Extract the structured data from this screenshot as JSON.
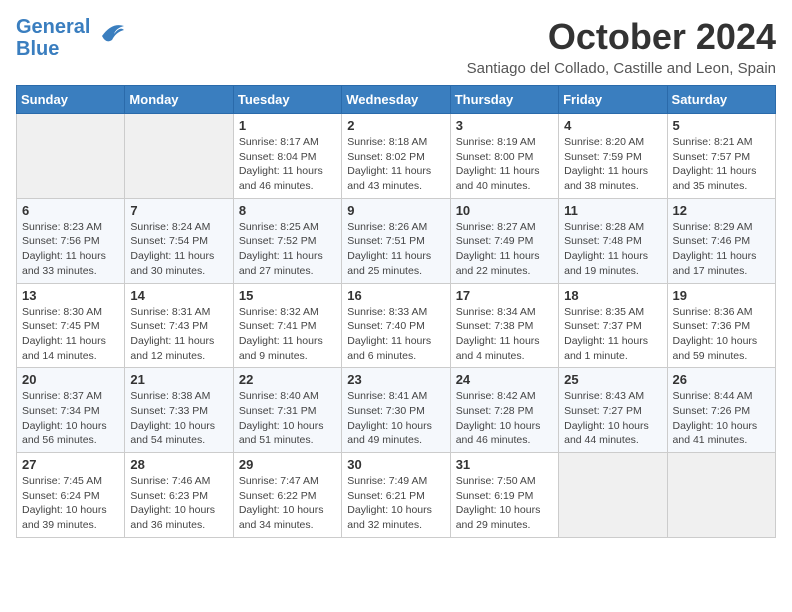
{
  "logo": {
    "line1": "General",
    "line2": "Blue"
  },
  "title": "October 2024",
  "location": "Santiago del Collado, Castille and Leon, Spain",
  "days_of_week": [
    "Sunday",
    "Monday",
    "Tuesday",
    "Wednesday",
    "Thursday",
    "Friday",
    "Saturday"
  ],
  "weeks": [
    [
      {
        "day": "",
        "info": ""
      },
      {
        "day": "",
        "info": ""
      },
      {
        "day": "1",
        "info": "Sunrise: 8:17 AM\nSunset: 8:04 PM\nDaylight: 11 hours and 46 minutes."
      },
      {
        "day": "2",
        "info": "Sunrise: 8:18 AM\nSunset: 8:02 PM\nDaylight: 11 hours and 43 minutes."
      },
      {
        "day": "3",
        "info": "Sunrise: 8:19 AM\nSunset: 8:00 PM\nDaylight: 11 hours and 40 minutes."
      },
      {
        "day": "4",
        "info": "Sunrise: 8:20 AM\nSunset: 7:59 PM\nDaylight: 11 hours and 38 minutes."
      },
      {
        "day": "5",
        "info": "Sunrise: 8:21 AM\nSunset: 7:57 PM\nDaylight: 11 hours and 35 minutes."
      }
    ],
    [
      {
        "day": "6",
        "info": "Sunrise: 8:23 AM\nSunset: 7:56 PM\nDaylight: 11 hours and 33 minutes."
      },
      {
        "day": "7",
        "info": "Sunrise: 8:24 AM\nSunset: 7:54 PM\nDaylight: 11 hours and 30 minutes."
      },
      {
        "day": "8",
        "info": "Sunrise: 8:25 AM\nSunset: 7:52 PM\nDaylight: 11 hours and 27 minutes."
      },
      {
        "day": "9",
        "info": "Sunrise: 8:26 AM\nSunset: 7:51 PM\nDaylight: 11 hours and 25 minutes."
      },
      {
        "day": "10",
        "info": "Sunrise: 8:27 AM\nSunset: 7:49 PM\nDaylight: 11 hours and 22 minutes."
      },
      {
        "day": "11",
        "info": "Sunrise: 8:28 AM\nSunset: 7:48 PM\nDaylight: 11 hours and 19 minutes."
      },
      {
        "day": "12",
        "info": "Sunrise: 8:29 AM\nSunset: 7:46 PM\nDaylight: 11 hours and 17 minutes."
      }
    ],
    [
      {
        "day": "13",
        "info": "Sunrise: 8:30 AM\nSunset: 7:45 PM\nDaylight: 11 hours and 14 minutes."
      },
      {
        "day": "14",
        "info": "Sunrise: 8:31 AM\nSunset: 7:43 PM\nDaylight: 11 hours and 12 minutes."
      },
      {
        "day": "15",
        "info": "Sunrise: 8:32 AM\nSunset: 7:41 PM\nDaylight: 11 hours and 9 minutes."
      },
      {
        "day": "16",
        "info": "Sunrise: 8:33 AM\nSunset: 7:40 PM\nDaylight: 11 hours and 6 minutes."
      },
      {
        "day": "17",
        "info": "Sunrise: 8:34 AM\nSunset: 7:38 PM\nDaylight: 11 hours and 4 minutes."
      },
      {
        "day": "18",
        "info": "Sunrise: 8:35 AM\nSunset: 7:37 PM\nDaylight: 11 hours and 1 minute."
      },
      {
        "day": "19",
        "info": "Sunrise: 8:36 AM\nSunset: 7:36 PM\nDaylight: 10 hours and 59 minutes."
      }
    ],
    [
      {
        "day": "20",
        "info": "Sunrise: 8:37 AM\nSunset: 7:34 PM\nDaylight: 10 hours and 56 minutes."
      },
      {
        "day": "21",
        "info": "Sunrise: 8:38 AM\nSunset: 7:33 PM\nDaylight: 10 hours and 54 minutes."
      },
      {
        "day": "22",
        "info": "Sunrise: 8:40 AM\nSunset: 7:31 PM\nDaylight: 10 hours and 51 minutes."
      },
      {
        "day": "23",
        "info": "Sunrise: 8:41 AM\nSunset: 7:30 PM\nDaylight: 10 hours and 49 minutes."
      },
      {
        "day": "24",
        "info": "Sunrise: 8:42 AM\nSunset: 7:28 PM\nDaylight: 10 hours and 46 minutes."
      },
      {
        "day": "25",
        "info": "Sunrise: 8:43 AM\nSunset: 7:27 PM\nDaylight: 10 hours and 44 minutes."
      },
      {
        "day": "26",
        "info": "Sunrise: 8:44 AM\nSunset: 7:26 PM\nDaylight: 10 hours and 41 minutes."
      }
    ],
    [
      {
        "day": "27",
        "info": "Sunrise: 7:45 AM\nSunset: 6:24 PM\nDaylight: 10 hours and 39 minutes."
      },
      {
        "day": "28",
        "info": "Sunrise: 7:46 AM\nSunset: 6:23 PM\nDaylight: 10 hours and 36 minutes."
      },
      {
        "day": "29",
        "info": "Sunrise: 7:47 AM\nSunset: 6:22 PM\nDaylight: 10 hours and 34 minutes."
      },
      {
        "day": "30",
        "info": "Sunrise: 7:49 AM\nSunset: 6:21 PM\nDaylight: 10 hours and 32 minutes."
      },
      {
        "day": "31",
        "info": "Sunrise: 7:50 AM\nSunset: 6:19 PM\nDaylight: 10 hours and 29 minutes."
      },
      {
        "day": "",
        "info": ""
      },
      {
        "day": "",
        "info": ""
      }
    ]
  ]
}
